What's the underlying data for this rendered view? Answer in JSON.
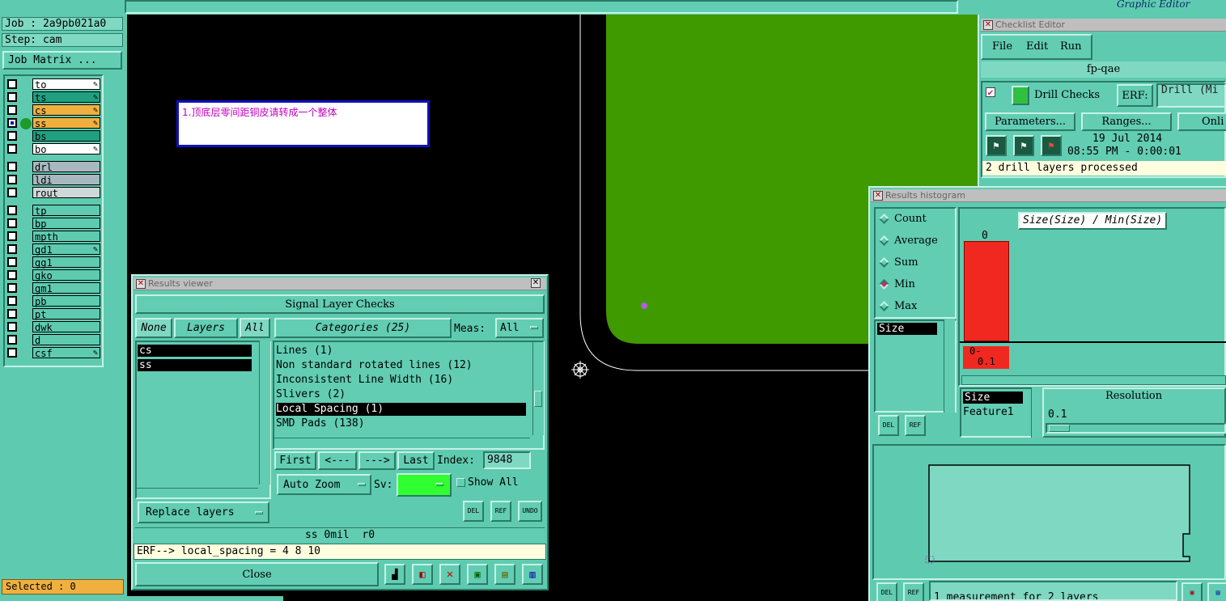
{
  "job": {
    "label": "Job : 2a9pb021a0",
    "step": "Step: cam",
    "matrix_button": "Job Matrix ..."
  },
  "layers": [
    {
      "name": "to",
      "color": "#ffffff",
      "icon": "pen-icon"
    },
    {
      "name": "ts",
      "color": "#20a080",
      "icon": "pen-icon"
    },
    {
      "name": "cs",
      "color": "#f0b040",
      "icon": "pen-icon"
    },
    {
      "name": "ss",
      "color": "#f0b040",
      "icon": "pen-icon"
    },
    {
      "name": "bs",
      "color": "#20a080",
      "icon": ""
    },
    {
      "name": "bo",
      "color": "#ffffff",
      "icon": "pen-icon"
    },
    {
      "name": "drl",
      "color": "#a8b8c0",
      "icon": ""
    },
    {
      "name": "ldi",
      "color": "#a8b8c0",
      "icon": ""
    },
    {
      "name": "rout",
      "color": "#cfd8d8",
      "icon": ""
    },
    {
      "name": "tp",
      "color": "#5ecbb0",
      "icon": ""
    },
    {
      "name": "bp",
      "color": "#5ecbb0",
      "icon": ""
    },
    {
      "name": "mpth",
      "color": "#5ecbb0",
      "icon": ""
    },
    {
      "name": "gd1",
      "color": "#5ecbb0",
      "icon": "pen-icon"
    },
    {
      "name": "gg1",
      "color": "#5ecbb0",
      "icon": ""
    },
    {
      "name": "gko",
      "color": "#5ecbb0",
      "icon": ""
    },
    {
      "name": "gm1",
      "color": "#5ecbb0",
      "icon": ""
    },
    {
      "name": "pb",
      "color": "#5ecbb0",
      "icon": ""
    },
    {
      "name": "pt",
      "color": "#5ecbb0",
      "icon": ""
    },
    {
      "name": "dwk",
      "color": "#5ecbb0",
      "icon": ""
    },
    {
      "name": "d",
      "color": "#5ecbb0",
      "icon": ""
    },
    {
      "name": "csf",
      "color": "#5ecbb0",
      "icon": "pen-icon"
    }
  ],
  "selected": "Selected : 0",
  "note": "1.顶底层零间距铜皮请转成一个整体",
  "app": {
    "subtitle": "Graphic Editor"
  },
  "checklist": {
    "title": "Checklist Editor",
    "menu": [
      "File",
      "Edit",
      "Run"
    ],
    "name": "fp-qae",
    "check_name": "Drill Checks",
    "erf_label": "ERF:",
    "erf_value": "Drill (Mi",
    "params_btn": "Parameters...",
    "ranges_btn": "Ranges...",
    "online_btn": "Onli",
    "date": "19 Jul 2014",
    "time": "08:55 PM - 0:00:01",
    "status": "2 drill layers processed"
  },
  "viewer": {
    "title": "Results viewer",
    "header": "Signal Layer Checks",
    "none": "None",
    "layers": "Layers",
    "all": "All",
    "categories": "Categories (25)",
    "meas_label": "Meas:",
    "meas_value": "All",
    "layer_list": [
      "cs",
      "ss"
    ],
    "category_list": [
      "Lines (1)",
      "Non standard rotated lines (12)",
      "Inconsistent Line Width (16)",
      "Slivers (2)",
      "Local Spacing (1)",
      "SMD Pads (138)"
    ],
    "selected_category": "Local Spacing (1)",
    "first": "First",
    "prev": "<---",
    "next": "--->",
    "last": "Last",
    "index_label": "Index:",
    "index_value": "9848",
    "auto_zoom": "Auto Zoom",
    "sv_label": "Sv:",
    "show_all": "Show All",
    "replace_layers": "Replace layers",
    "del": "DEL",
    "ref": "REF",
    "undo": "UNDO",
    "info": "ss 0mil  r0",
    "erf_line": "ERF--> local_spacing = 4 8 10",
    "close": "Close"
  },
  "histogram": {
    "title": "Results histogram",
    "options": [
      "Count",
      "Average",
      "Sum",
      "Min",
      "Max"
    ],
    "selected_option": "Min",
    "list_item": "Size",
    "chart_title": "Size(Size) / Min(Size)",
    "bar_label": "0",
    "bin_label_1": "0-",
    "bin_label_2": "0.1",
    "attrs": [
      "Size",
      "Feature1"
    ],
    "resolution_label": "Resolution",
    "resolution_value": "0.1",
    "del": "DEL",
    "ref": "REF",
    "status": "1 measurement for 2 layers"
  }
}
